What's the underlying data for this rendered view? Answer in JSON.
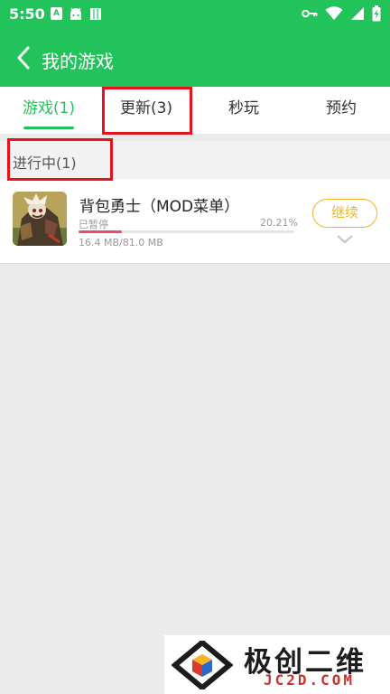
{
  "status_bar": {
    "time": "5:50",
    "left_icons": [
      "a-app-icon",
      "android-icon",
      "book-icon"
    ],
    "right_icons": [
      "key-icon",
      "wifi-icon",
      "signal-icon",
      "battery-charging-icon"
    ]
  },
  "header": {
    "title": "我的游戏",
    "back_icon": "chevron-left-icon"
  },
  "tabs": [
    {
      "label": "游戏(1)",
      "active": true
    },
    {
      "label": "更新(3)",
      "active": false
    },
    {
      "label": "秒玩",
      "active": false
    },
    {
      "label": "预约",
      "active": false
    }
  ],
  "section": {
    "label": "进行中(1)"
  },
  "game": {
    "title": "背包勇士（MOD菜单）",
    "status": "已暂停",
    "percent_text": "20.21%",
    "progress": 0.2021,
    "size_text": "16.4 MB/81.0 MB",
    "continue_label": "继续",
    "expand_icon": "chevron-down-icon"
  },
  "watermark": {
    "cn_text": "极创二维",
    "en_text": "JC2D.COM"
  },
  "colors": {
    "primary": "#23c35b",
    "progress": "#ef4a63",
    "continue": "#f0b623",
    "annotation": "#e8131a"
  }
}
